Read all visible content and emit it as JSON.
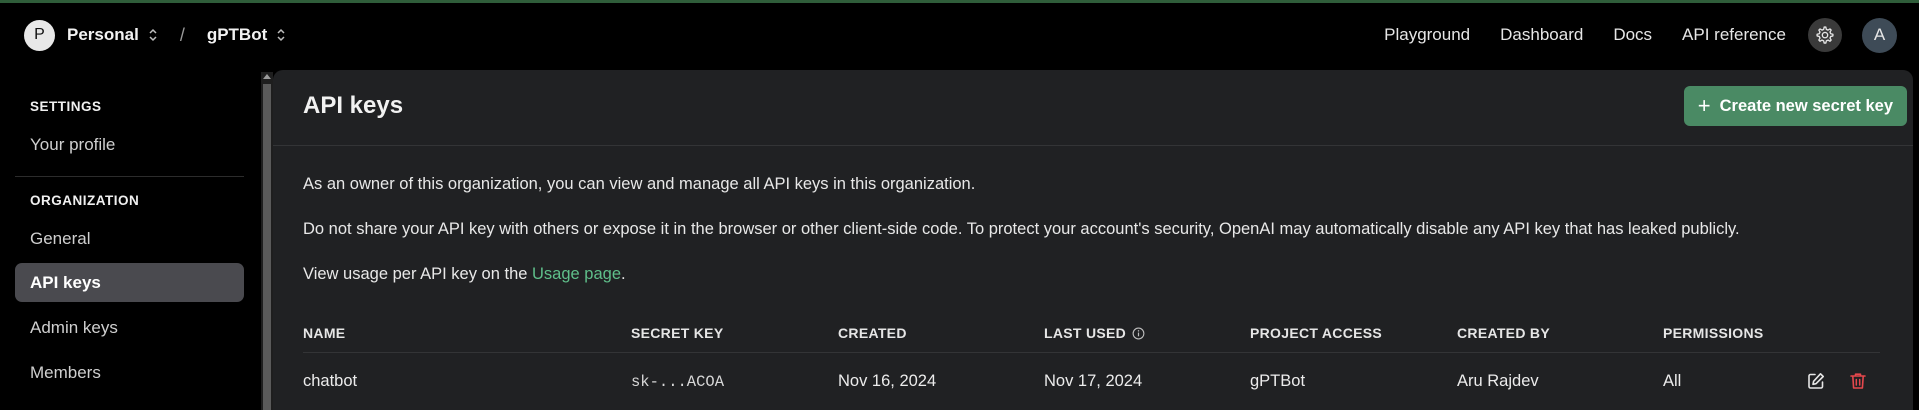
{
  "header": {
    "org_initial": "P",
    "org_name": "Personal",
    "separator": "/",
    "project_name": "gPTBot",
    "nav": [
      "Playground",
      "Dashboard",
      "Docs",
      "API reference"
    ],
    "user_initial": "A"
  },
  "sidebar": {
    "settings_heading": "SETTINGS",
    "your_profile": "Your profile",
    "org_heading": "ORGANIZATION",
    "items": [
      "General",
      "API keys",
      "Admin keys",
      "Members"
    ],
    "active": "API keys"
  },
  "main": {
    "title": "API keys",
    "create_button": "Create new secret key",
    "para1": "As an owner of this organization, you can view and manage all API keys in this organization.",
    "para2": "Do not share your API key with others or expose it in the browser or other client-side code. To protect your account's security, OpenAI may automatically disable any API key that has leaked publicly.",
    "para3_prefix": "View usage per API key on the ",
    "para3_link": "Usage page",
    "para3_suffix": "."
  },
  "table": {
    "columns": [
      "NAME",
      "SECRET KEY",
      "CREATED",
      "LAST USED",
      "PROJECT ACCESS",
      "CREATED BY",
      "PERMISSIONS"
    ],
    "rows": [
      {
        "name": "chatbot",
        "secret_key": "sk-...ACOA",
        "created": "Nov 16, 2024",
        "last_used": "Nov 17, 2024",
        "project_access": "gPTBot",
        "created_by": "Aru Rajdev",
        "permissions": "All"
      }
    ]
  },
  "colors": {
    "accent_green": "#4a8a64",
    "link_green": "#5fbf8a",
    "delete_red": "#e5484d",
    "panel_bg": "#202123"
  },
  "icons": [
    "chevron-updown-icon",
    "gear-icon",
    "plus-icon",
    "info-icon",
    "edit-icon",
    "trash-icon"
  ]
}
